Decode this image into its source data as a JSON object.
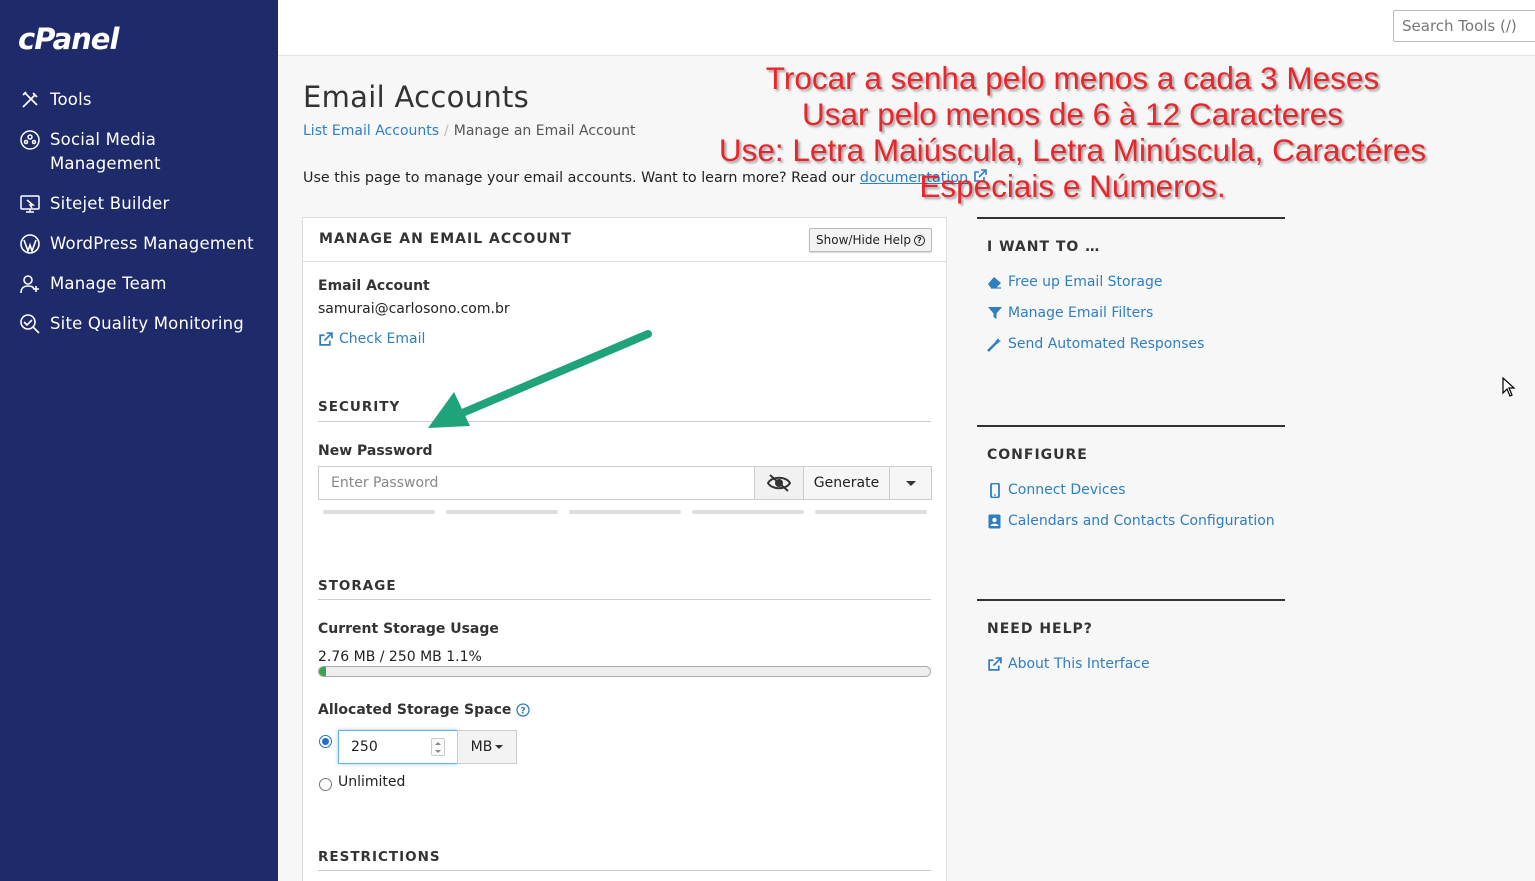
{
  "brand": "cPanel",
  "sidebar": {
    "items": [
      {
        "label": "Tools",
        "icon": "tools-icon"
      },
      {
        "label": "Social Media\nManagement",
        "icon": "social-media-icon"
      },
      {
        "label": "Sitejet Builder",
        "icon": "sitejet-icon"
      },
      {
        "label": "WordPress Management",
        "icon": "wordpress-icon"
      },
      {
        "label": "Manage Team",
        "icon": "team-icon"
      },
      {
        "label": "Site Quality Monitoring",
        "icon": "quality-monitor-icon"
      }
    ]
  },
  "topbar": {
    "search_placeholder": "Search Tools (/)"
  },
  "page": {
    "title": "Email Accounts",
    "breadcrumb": {
      "link": "List Email Accounts",
      "sep": "/",
      "current": "Manage an Email Account"
    },
    "intro": "Use this page to manage your email accounts. Want to learn more? Read our ",
    "intro_link": "documentation"
  },
  "annotation": {
    "line1": "Trocar a senha pelo menos a cada 3 Meses",
    "line2": "Usar pelo menos de 6 à 12 Caracteres",
    "line3": "Use: Letra Maiúscula, Letra Minúscula, Caractéres",
    "line4": "Especiais e Números.",
    "color": "#e8262b",
    "arrow_color": "#1fa37a"
  },
  "panel": {
    "title": "MANAGE AN EMAIL ACCOUNT",
    "help_button": "Show/Hide Help",
    "email_label": "Email Account",
    "email_value": "samurai@carlosono.com.br",
    "check_email": "Check Email",
    "security": {
      "heading": "SECURITY",
      "new_password_label": "New Password",
      "password_placeholder": "Enter Password",
      "generate": "Generate",
      "strength_level": 0
    },
    "storage": {
      "heading": "STORAGE",
      "current_label": "Current Storage Usage",
      "usage_text": "2.76 MB / 250 MB 1.1%",
      "usage_percent": 1.1,
      "allocated_label": "Allocated Storage Space",
      "allocated_value": "250",
      "unit": "MB",
      "unlimited": "Unlimited",
      "selected": "custom"
    },
    "restrictions": {
      "heading": "RESTRICTIONS"
    }
  },
  "right": {
    "i_want_to": {
      "heading": "I WANT TO …",
      "links": [
        "Free up Email Storage",
        "Manage Email Filters",
        "Send Automated Responses"
      ]
    },
    "configure": {
      "heading": "CONFIGURE",
      "links": [
        "Connect Devices",
        "Calendars and Contacts Configuration"
      ]
    },
    "need_help": {
      "heading": "NEED HELP?",
      "links": [
        "About This Interface"
      ]
    }
  }
}
